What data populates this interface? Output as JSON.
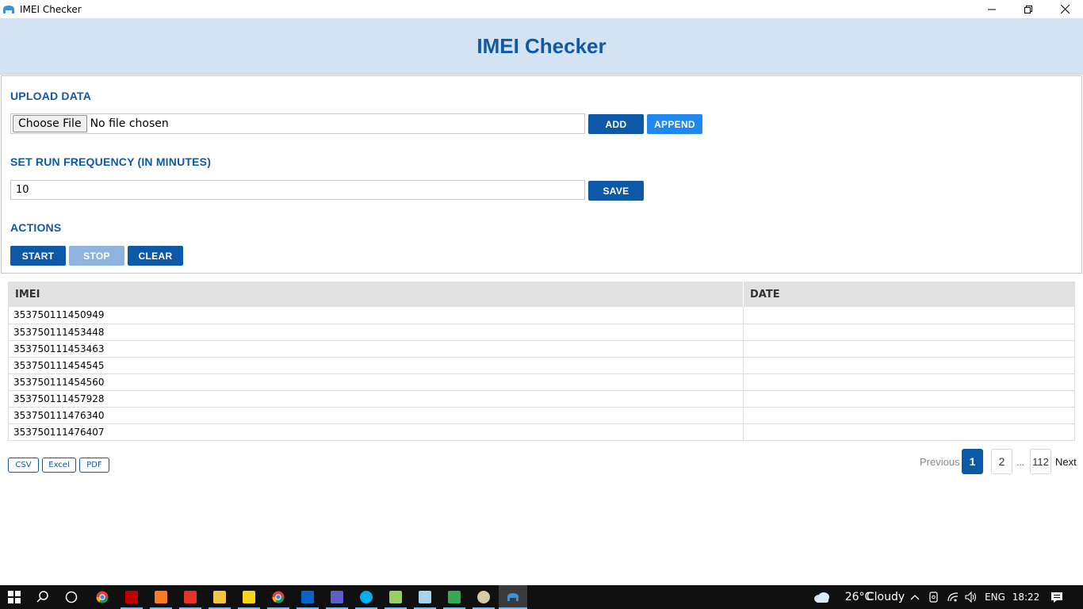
{
  "window": {
    "title": "IMEI Checker"
  },
  "header": {
    "title": "IMEI Checker"
  },
  "upload": {
    "heading": "UPLOAD DATA",
    "choose_label": "Choose File",
    "file_status": "No file chosen",
    "add_label": "ADD",
    "append_label": "APPEND"
  },
  "frequency": {
    "heading": "SET RUN FREQUENCY (IN MINUTES)",
    "value": "10",
    "save_label": "SAVE"
  },
  "actions": {
    "heading": "ACTIONS",
    "start_label": "START",
    "stop_label": "STOP",
    "clear_label": "CLEAR"
  },
  "table": {
    "columns": [
      "IMEI",
      "DATE"
    ],
    "rows": [
      {
        "imei": "353750111450949",
        "date": ""
      },
      {
        "imei": "353750111453448",
        "date": ""
      },
      {
        "imei": "353750111453463",
        "date": ""
      },
      {
        "imei": "353750111454545",
        "date": ""
      },
      {
        "imei": "353750111454560",
        "date": ""
      },
      {
        "imei": "353750111457928",
        "date": ""
      },
      {
        "imei": "353750111476340",
        "date": ""
      },
      {
        "imei": "353750111476407",
        "date": ""
      }
    ]
  },
  "export": {
    "csv": "CSV",
    "excel": "Excel",
    "pdf": "PDF"
  },
  "pagination": {
    "previous": "Previous",
    "current": "1",
    "second": "2",
    "ellipsis": "...",
    "last": "112",
    "next": "Next"
  },
  "taskbar": {
    "weather_temp": "26°C",
    "weather_text": "Cloudy",
    "language": "ENG",
    "time": "18:22"
  },
  "colors": {
    "accent": "#0e58a8",
    "header_bg": "#d4e3f4",
    "append_blue": "#1e88f0",
    "disabled": "#8fb3dc"
  }
}
